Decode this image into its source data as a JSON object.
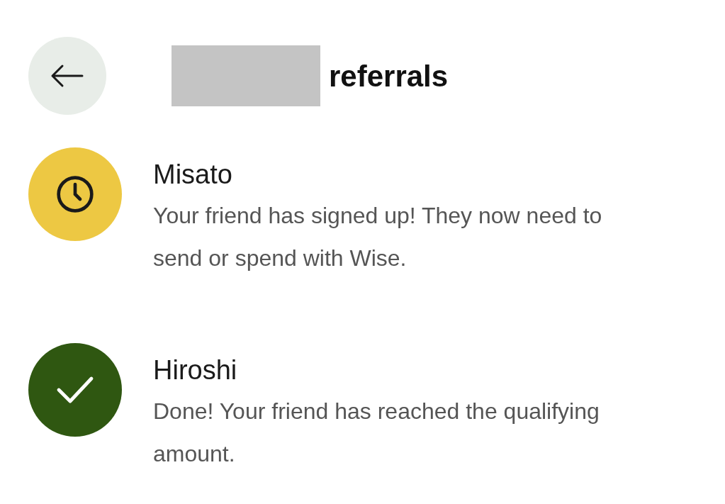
{
  "header": {
    "title": "referrals"
  },
  "referrals": [
    {
      "name": "Misato",
      "kind": "pending",
      "description": "Your friend has signed up! They now need to send or spend with Wise."
    },
    {
      "name": "Hiroshi",
      "kind": "done",
      "description": "Done! Your friend has reached the qualifying amount."
    }
  ]
}
